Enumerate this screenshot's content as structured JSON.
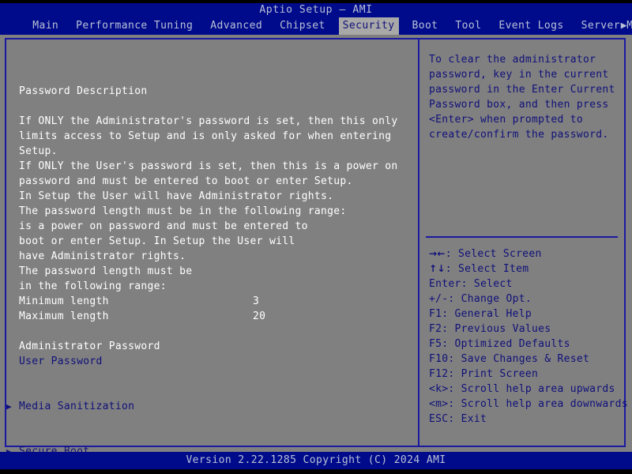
{
  "window": {
    "title": "Aptio Setup – AMI"
  },
  "menubar": {
    "items": [
      {
        "label": "Main",
        "active": false
      },
      {
        "label": "Performance Tuning",
        "active": false
      },
      {
        "label": "Advanced",
        "active": false
      },
      {
        "label": "Chipset",
        "active": false
      },
      {
        "label": "Security",
        "active": true
      },
      {
        "label": "Boot",
        "active": false
      },
      {
        "label": "Tool",
        "active": false
      },
      {
        "label": "Event Logs",
        "active": false
      },
      {
        "label": "Server Mgmt",
        "active": false
      }
    ],
    "scroll_right_icon": "▶"
  },
  "main": {
    "heading": "Password Description",
    "description_lines": [
      "If ONLY the Administrator's password is set, then this only",
      "limits access to Setup and is only asked for when entering",
      "Setup.",
      "If ONLY the User's password is set, then this is a power on",
      "password and must be entered to boot or enter Setup.",
      "In Setup the User will have Administrator rights.",
      "The password length must be in the following range:",
      "is a power on password and must be entered to",
      "boot or enter Setup. In Setup the User will",
      "have Administrator rights.",
      "The password length must be",
      "in the following range:"
    ],
    "length_rows": [
      {
        "label": "Minimum length",
        "value": "3"
      },
      {
        "label": "Maximum length",
        "value": "20"
      }
    ],
    "password_items": [
      {
        "label": "Administrator Password",
        "style": "plain"
      },
      {
        "label": "User Password",
        "style": "selectable"
      }
    ],
    "submenu_items": [
      {
        "label": "Media Sanitization",
        "arrow": "▶"
      },
      {
        "label": "Secure Boot",
        "arrow": "▶"
      }
    ]
  },
  "help": {
    "lines": [
      "To clear the administrator",
      "password, key in the current",
      "password in the Enter Current",
      "Password box, and then press",
      "<Enter> when prompted to",
      "create/confirm the password."
    ]
  },
  "keys": [
    {
      "glyph": "→←",
      "text": ": Select Screen"
    },
    {
      "glyph": "↑↓",
      "text": ": Select Item"
    },
    {
      "glyph": "",
      "text": "Enter: Select"
    },
    {
      "glyph": "",
      "text": "+/-: Change Opt."
    },
    {
      "glyph": "",
      "text": "F1: General Help"
    },
    {
      "glyph": "",
      "text": "F2: Previous Values"
    },
    {
      "glyph": "",
      "text": "F5: Optimized Defaults"
    },
    {
      "glyph": "",
      "text": "F10: Save Changes & Reset"
    },
    {
      "glyph": "",
      "text": "F12: Print Screen"
    },
    {
      "glyph": "",
      "text": "<k>: Scroll help area upwards"
    },
    {
      "glyph": "",
      "text": "<m>: Scroll help area downwards"
    },
    {
      "glyph": "",
      "text": "ESC: Exit"
    }
  ],
  "footer": {
    "text": "Version 2.22.1285 Copyright (C) 2024 AMI"
  },
  "colors": {
    "bios_blue": "#000b8c",
    "panel_gray": "#808080",
    "border_blue": "#1a1aa0",
    "item_blue": "#10107a",
    "text_white": "#ffffff",
    "menu_text": "#b9c0d4",
    "highlight_bg": "#a8a8a8"
  }
}
